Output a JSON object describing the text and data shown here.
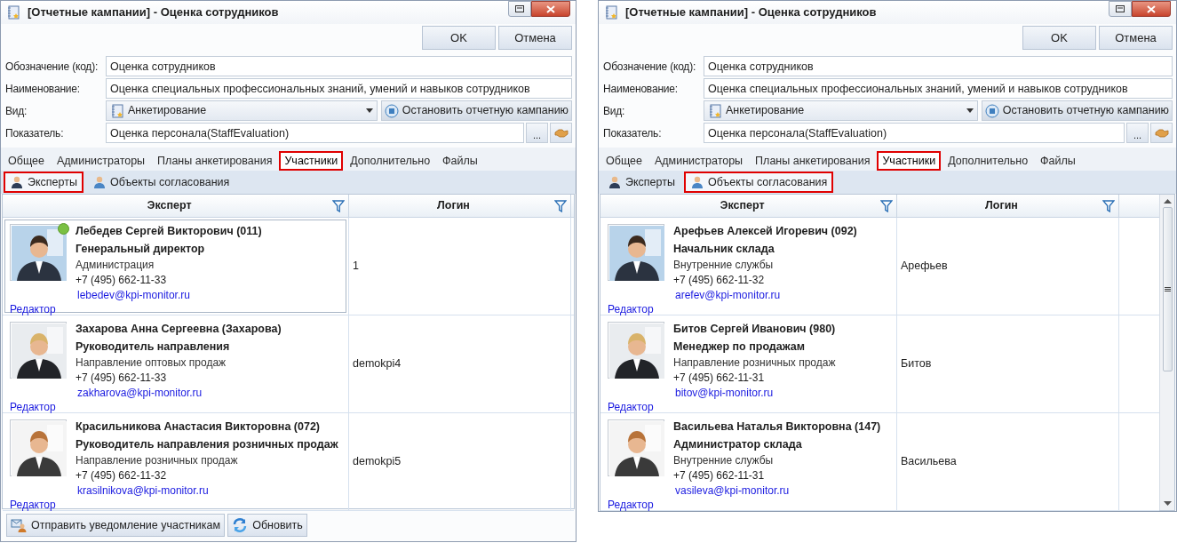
{
  "windows": [
    {
      "title": "[Отчетные кампании] - Оценка сотрудников",
      "scrollbar": false,
      "buttons": [
        "OK",
        "Отмена"
      ],
      "fields": [
        {
          "kind": "text",
          "label": "Обозначение (код):",
          "value": "Оценка сотрудников"
        },
        {
          "kind": "text",
          "label": "Наименование:",
          "value": "Оценка специальных профессиональных знаний, умений и навыков сотрудников"
        },
        {
          "kind": "dropdown",
          "label": "Вид:",
          "value": "Анкетирование",
          "action": "Остановить отчетную кампанию"
        },
        {
          "kind": "picker",
          "label": "Показатель:",
          "value": "Оценка персонала(StaffEvaluation)",
          "browse": "..."
        }
      ],
      "tabs": [
        {
          "label": "Общее",
          "selected": false,
          "highlighted": false
        },
        {
          "label": "Администраторы",
          "selected": false,
          "highlighted": false
        },
        {
          "label": "Планы анкетирования",
          "selected": false,
          "highlighted": false
        },
        {
          "label": "Участники",
          "selected": true,
          "highlighted": true
        },
        {
          "label": "Дополнительно",
          "selected": false,
          "highlighted": false
        },
        {
          "label": "Файлы",
          "selected": false,
          "highlighted": false
        }
      ],
      "subtabs": [
        {
          "label": "Эксперты",
          "selected": true,
          "highlighted": true
        },
        {
          "label": "Объекты согласования",
          "selected": false,
          "highlighted": false
        }
      ],
      "table": {
        "columns": [
          "Эксперт",
          "Логин"
        ],
        "rows": [
          {
            "name": "Лебедев Сергей Викторович  (011)",
            "position": "Генеральный директор",
            "department": "Администрация",
            "phone": "+7 (495) 662-11-33",
            "email": "lebedev@kpi-monitor.ru",
            "editor": "Редактор",
            "login": "1",
            "online": true,
            "selected": true
          },
          {
            "name": "Захарова Анна Сергеевна  (Захарова)",
            "position": "Руководитель направления",
            "department": "Направление оптовых продаж",
            "phone": "+7 (495) 662-11-33",
            "email": "zakharova@kpi-monitor.ru",
            "editor": "Редактор",
            "login": "demokpi4",
            "online": false,
            "selected": false
          },
          {
            "name": "Красильникова Анастасия Викторовна  (072)",
            "position": "Руководитель направления розничных продаж",
            "department": "Направление розничных продаж",
            "phone": "+7 (495) 662-11-32",
            "email": "krasilnikova@kpi-monitor.ru",
            "editor": "Редактор",
            "login": "demokpi5",
            "online": false,
            "selected": false
          }
        ]
      },
      "footer_buttons": [
        "Отправить уведомление участникам",
        "Обновить"
      ]
    },
    {
      "title": "[Отчетные кампании] - Оценка сотрудников",
      "scrollbar": true,
      "buttons": [
        "OK",
        "Отмена"
      ],
      "fields": [
        {
          "kind": "text",
          "label": "Обозначение (код):",
          "value": "Оценка сотрудников"
        },
        {
          "kind": "text",
          "label": "Наименование:",
          "value": "Оценка специальных профессиональных знаний, умений и навыков сотрудников"
        },
        {
          "kind": "dropdown",
          "label": "Вид:",
          "value": "Анкетирование",
          "action": "Остановить отчетную кампанию"
        },
        {
          "kind": "picker",
          "label": "Показатель:",
          "value": "Оценка персонала(StaffEvaluation)",
          "browse": "..."
        }
      ],
      "tabs": [
        {
          "label": "Общее",
          "selected": false,
          "highlighted": false
        },
        {
          "label": "Администраторы",
          "selected": false,
          "highlighted": false
        },
        {
          "label": "Планы анкетирования",
          "selected": false,
          "highlighted": false
        },
        {
          "label": "Участники",
          "selected": true,
          "highlighted": true
        },
        {
          "label": "Дополнительно",
          "selected": false,
          "highlighted": false
        },
        {
          "label": "Файлы",
          "selected": false,
          "highlighted": false
        }
      ],
      "subtabs": [
        {
          "label": "Эксперты",
          "selected": false,
          "highlighted": false
        },
        {
          "label": "Объекты согласования",
          "selected": true,
          "highlighted": true
        }
      ],
      "table": {
        "columns": [
          "Эксперт",
          "Логин"
        ],
        "rows": [
          {
            "name": "Арефьев Алексей Игоревич  (092)",
            "position": "Начальник склада",
            "department": "Внутренние службы",
            "phone": "+7 (495) 662-11-32",
            "email": "arefev@kpi-monitor.ru",
            "editor": "Редактор",
            "login": "Арефьев",
            "online": false,
            "selected": false
          },
          {
            "name": "Битов Сергей Иванович (980)",
            "position": "Менеджер по продажам",
            "department": "Направление розничных продаж",
            "phone": "+7 (495) 662-11-31",
            "email": "bitov@kpi-monitor.ru",
            "editor": "Редактор",
            "login": "Битов",
            "online": false,
            "selected": false
          },
          {
            "name": "Васильева Наталья Викторовна  (147)",
            "position": "Администратор склада",
            "department": "Внутренние службы",
            "phone": "+7 (495) 662-11-31",
            "email": "vasileva@kpi-monitor.ru",
            "editor": "Редактор",
            "login": "Васильева",
            "online": false,
            "selected": false
          }
        ]
      }
    }
  ]
}
